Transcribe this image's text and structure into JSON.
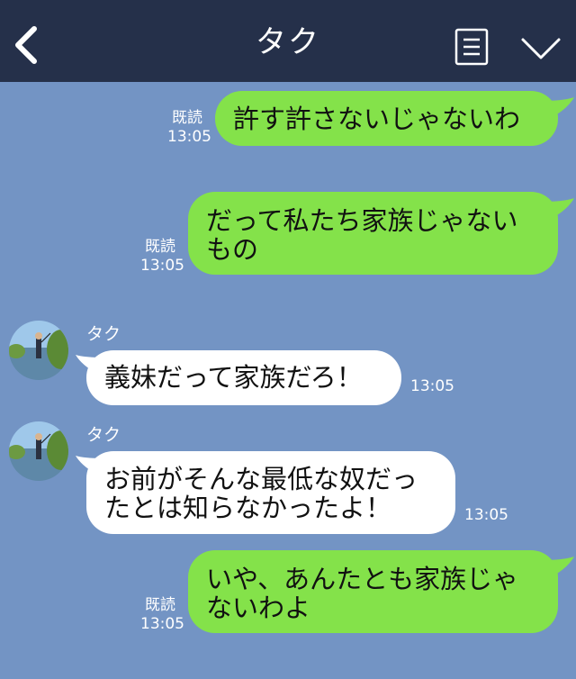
{
  "header": {
    "title": "タク"
  },
  "messages": [
    {
      "type": "sent",
      "text": "許す許さないじゃないわ",
      "read": "既読",
      "time": "13:05"
    },
    {
      "type": "sent",
      "text": "だって私たち家族じゃない\nもの",
      "read": "既読",
      "time": "13:05"
    },
    {
      "type": "received",
      "sender": "タク",
      "text": "義妹だって家族だろ！",
      "time": "13:05"
    },
    {
      "type": "received",
      "sender": "タク",
      "text": "お前がそんな最低な奴だっ\nたとは知らなかったよ！",
      "time": "13:05"
    },
    {
      "type": "sent",
      "text": "いや、あんたとも家族じゃ\nないわよ",
      "read": "既読",
      "time": "13:05"
    }
  ],
  "colors": {
    "header_bg": "#25304a",
    "chat_bg": "#7394c4",
    "sent_bubble": "#84e24a",
    "received_bubble": "#ffffff"
  },
  "icons": [
    "back-arrow-icon",
    "menu-list-icon",
    "chevron-down-icon",
    "avatar-icon"
  ]
}
